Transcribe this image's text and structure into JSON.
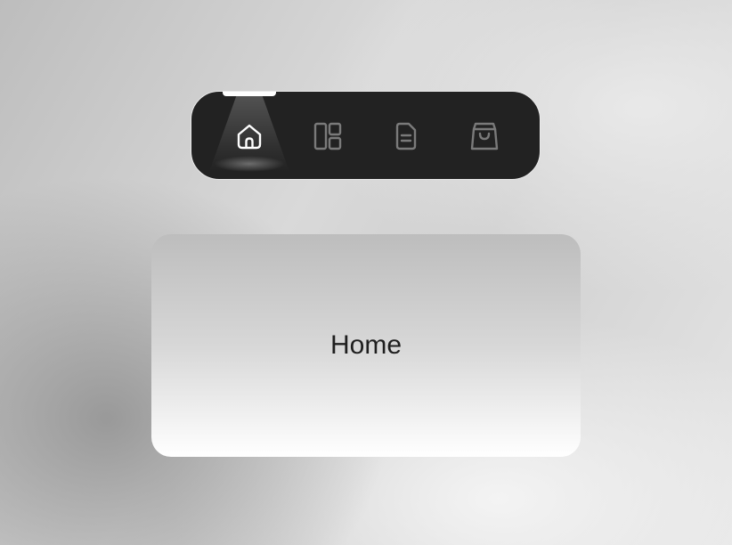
{
  "nav": {
    "items": [
      {
        "icon": "home-icon",
        "active": true
      },
      {
        "icon": "layout-icon",
        "active": false
      },
      {
        "icon": "document-icon",
        "active": false
      },
      {
        "icon": "shopping-bag-icon",
        "active": false
      }
    ],
    "active_color": "#ffffff",
    "inactive_color": "#7a7a7a",
    "background": "#222222"
  },
  "content": {
    "title": "Home"
  }
}
